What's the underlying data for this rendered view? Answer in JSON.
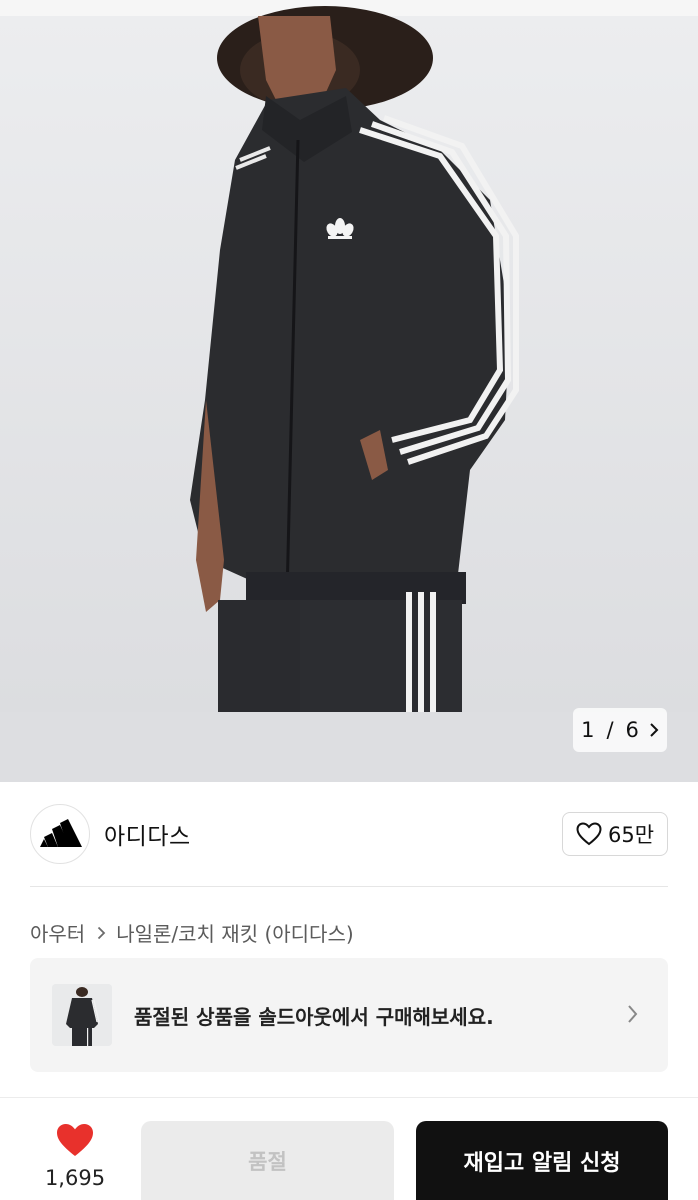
{
  "gallery": {
    "image_alt": "아디다스 트랙 재킷 상품 사진",
    "current": "1",
    "separator": "/",
    "total": "6"
  },
  "brand": {
    "name": "아디다스",
    "logo_icon": "adidas-logo",
    "like_icon": "heart-outline-icon",
    "like_count": "65만"
  },
  "breadcrumb": {
    "category": "아우터",
    "chevron_icon": "chevron-right-icon",
    "product": "나일론/코치 재킷 (아디다스)"
  },
  "notice": {
    "text": "품절된 상품을 솔드아웃에서 구매해보세요.",
    "chevron_icon": "chevron-right-icon"
  },
  "bottom_bar": {
    "wish_icon": "heart-filled-icon",
    "wish_count": "1,695",
    "soldout_label": "품절",
    "restock_label": "재입고 알림 신청"
  },
  "colors": {
    "heart_red": "#e8312c",
    "primary_button": "#111111",
    "disabled_button": "#ebebeb",
    "photo_background": "#e4e5e7"
  }
}
